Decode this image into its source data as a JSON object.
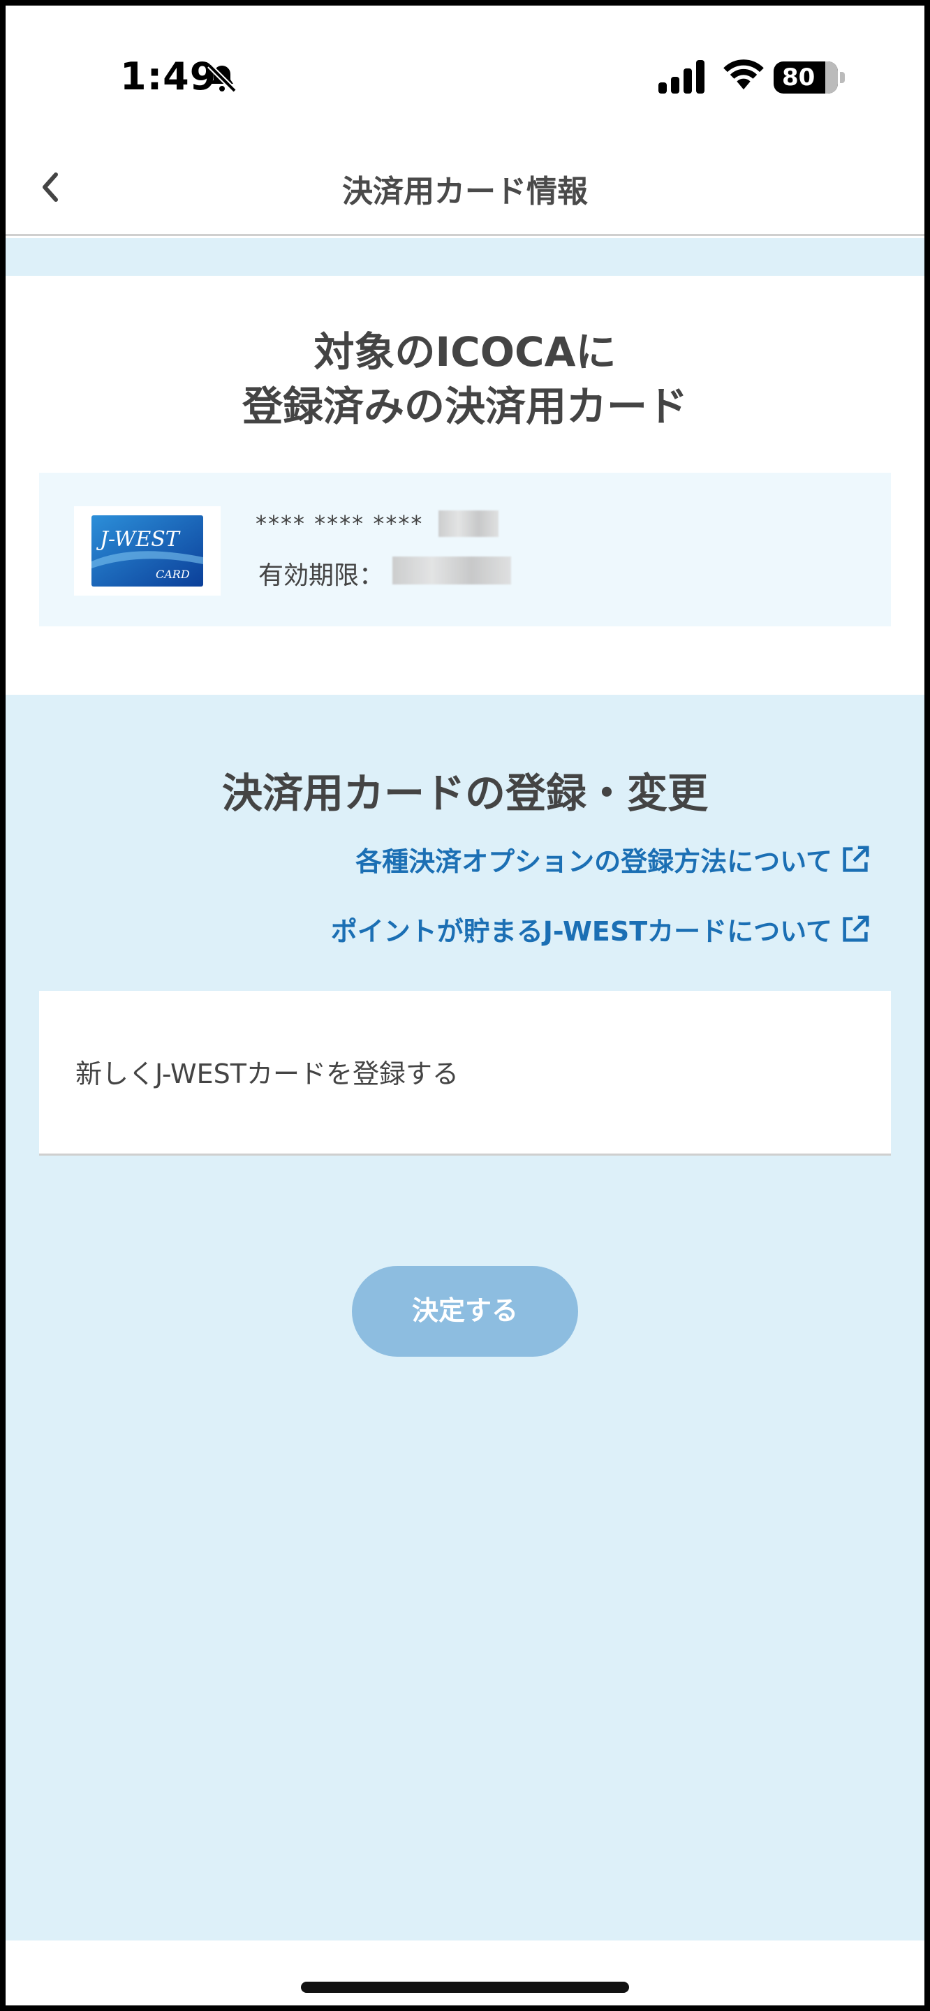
{
  "status_bar": {
    "time": "1:49",
    "battery_percent": "80",
    "icons": [
      "bell-slash-icon",
      "cellular-signal-icon",
      "wifi-icon",
      "battery-icon"
    ]
  },
  "nav": {
    "title": "決済用カード情報",
    "back_icon": "chevron-left-icon"
  },
  "registered_section": {
    "title_line1": "対象のICOCAに",
    "title_line2": "登録済みの決済用カード",
    "card": {
      "logo_text": "J-WEST",
      "logo_sub": "CARD",
      "masked_number": "**** **** ****",
      "expiry_label": "有効期限："
    }
  },
  "change_section": {
    "title": "決済用カードの登録・変更",
    "links": [
      {
        "label": "各種決済オプションの登録方法について",
        "icon": "external-link-icon"
      },
      {
        "label": "ポイントが貯まるJ-WESTカードについて",
        "icon": "external-link-icon"
      }
    ],
    "option_label": "新しくJ-WESTカードを登録する",
    "submit_label": "決定する"
  },
  "colors": {
    "accent_link": "#1b6fb4",
    "content_bg": "#ddf0f9",
    "button_disabled": "#8dbde0"
  }
}
